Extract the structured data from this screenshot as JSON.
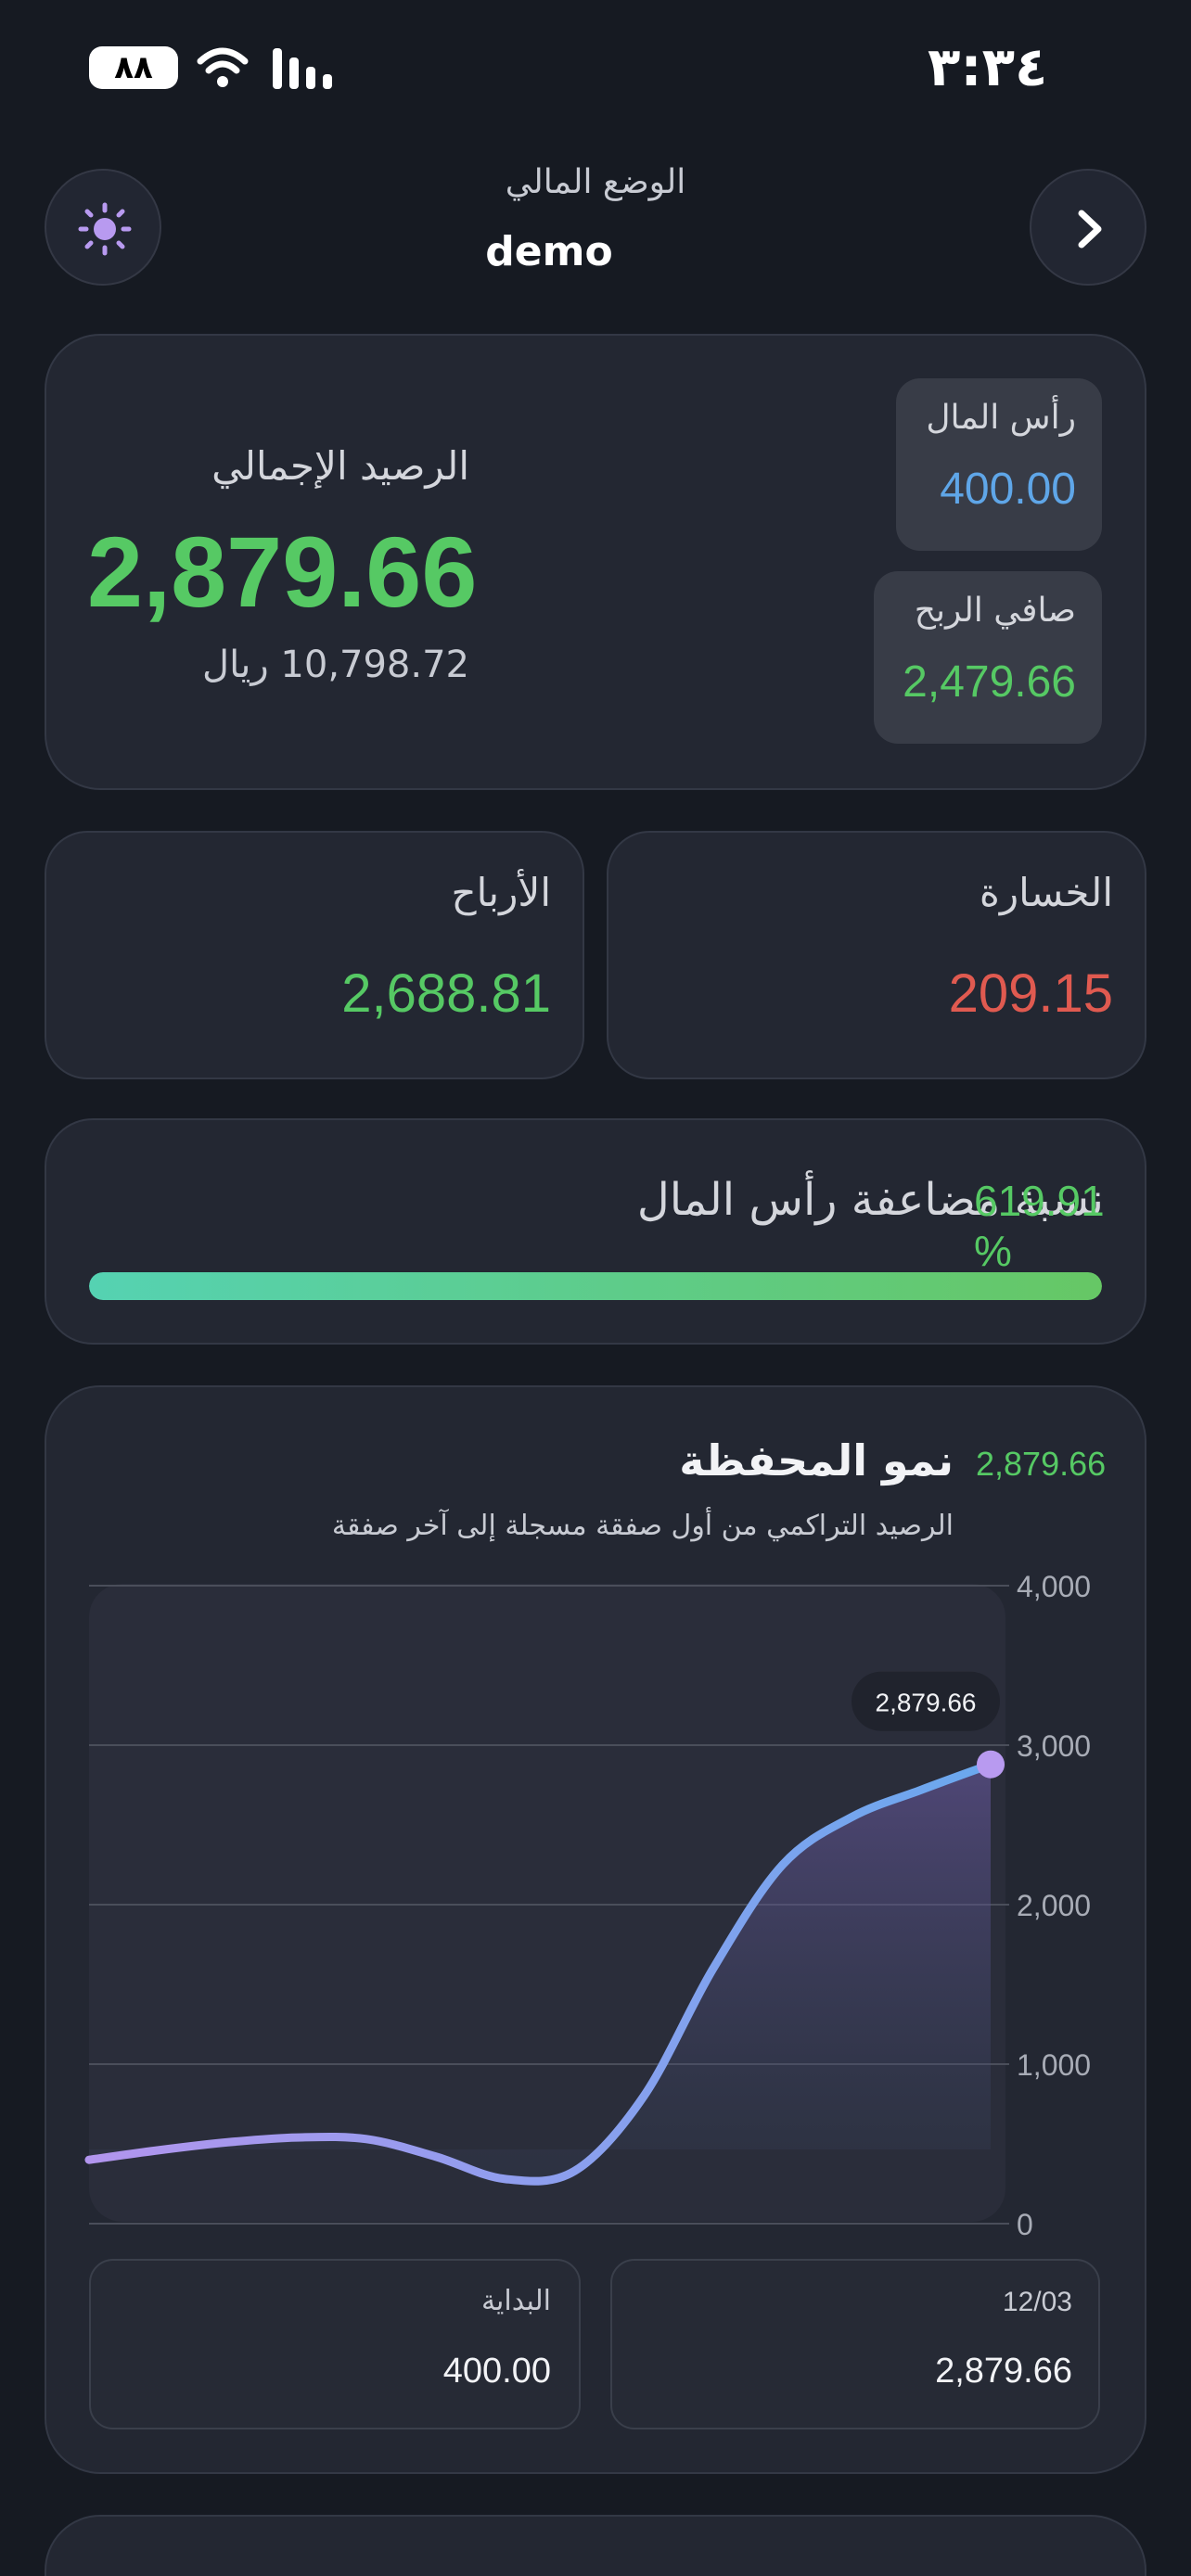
{
  "status_bar": {
    "time": "٣:٣٤",
    "battery": "٨٨"
  },
  "header": {
    "subtitle": "الوضع المالي",
    "title": "demo"
  },
  "summary": {
    "total_label": "الرصيد الإجمالي",
    "total_value": "2,879.66",
    "local_value": "10,798.72 ريال",
    "capital_label": "رأس المال",
    "capital_value": "400.00",
    "net_profit_label": "صافي الربح",
    "net_profit_value": "2,479.66"
  },
  "wins_losses": {
    "loss_label": "الخسارة",
    "loss_value": "209.15",
    "profit_label": "الأرباح",
    "profit_value": "2,688.81"
  },
  "capital_multiple": {
    "label": "نسبة مضاعفة رأس المال",
    "value": "619.91 %",
    "progress_fraction": 1.0
  },
  "growth": {
    "title": "نمو المحفظة",
    "current": "2,879.66",
    "subtitle": "الرصيد التراكمي من أول صفقة مسجلة إلى آخر صفقة",
    "tooltip": "2,879.66",
    "start_label": "البداية",
    "start_value": "400.00",
    "end_label": "12/03",
    "end_value": "2,879.66"
  },
  "chart_data": {
    "type": "area",
    "ylim": [
      0,
      4000
    ],
    "y_ticks": [
      0,
      1000,
      2000,
      3000,
      4000
    ],
    "y_tick_labels": [
      "0",
      "1,000",
      "2,000",
      "3,000",
      "4,000"
    ],
    "grid": true,
    "series": [
      {
        "values": [
          400,
          460,
          510,
          540,
          530,
          420,
          280,
          330,
          800,
          1600,
          2250,
          2550,
          2720,
          2879.66
        ]
      }
    ]
  },
  "colors": {
    "positive": "#56c964",
    "negative": "#e05a50",
    "capital": "#5fa6e8",
    "accent": "#b89af0",
    "line_start": "#b295ee",
    "line_end": "#6aa8ee"
  },
  "icons": {
    "theme": "sun-icon",
    "nav": "chevron-right-icon",
    "wifi": "wifi-icon",
    "signal": "signal-icon",
    "battery": "battery-icon"
  }
}
